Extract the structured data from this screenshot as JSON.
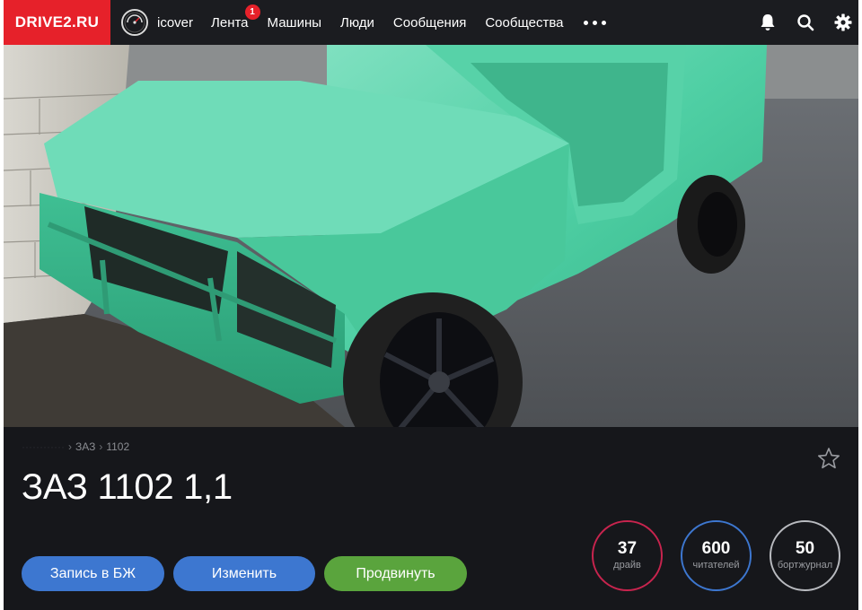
{
  "header": {
    "logo": "DRIVE2.RU",
    "username": "icover",
    "nav": [
      {
        "label": "Лента",
        "badge": "1"
      },
      {
        "label": "Машины"
      },
      {
        "label": "Люди"
      },
      {
        "label": "Сообщения"
      },
      {
        "label": "Сообщества"
      }
    ],
    "icons": [
      "more-dots-icon",
      "bell-icon",
      "search-icon",
      "gear-icon"
    ]
  },
  "hero": {
    "subject": "car-photo"
  },
  "car": {
    "breadcrumb": [
      "ЗАЗ",
      "1102"
    ],
    "title": "ЗАЗ 1102 1,1"
  },
  "actions": {
    "logbook_label": "Запись в БЖ",
    "edit_label": "Изменить",
    "promote_label": "Продвинуть"
  },
  "stats": [
    {
      "value": "37",
      "label": "драйв"
    },
    {
      "value": "600",
      "label": "читателей"
    },
    {
      "value": "50",
      "label": "бортжурнал"
    }
  ],
  "colors": {
    "brand": "#e6212a",
    "button_blue": "#3d77d0",
    "button_green": "#5aa43d",
    "drive_ring": "#c8244e",
    "readers_ring": "#3d77d0",
    "logbook_ring": "#b9bbc0"
  }
}
